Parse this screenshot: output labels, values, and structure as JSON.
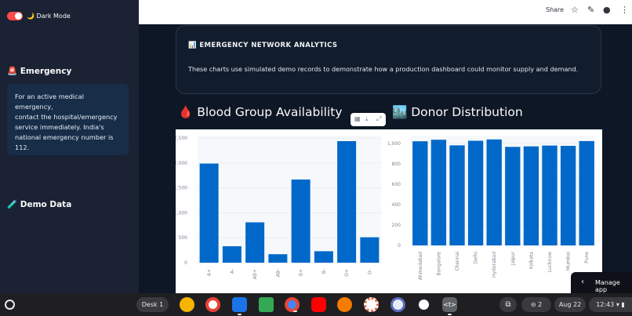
{
  "sidebar": {
    "toggle_label": "🌙 Dark Mode",
    "emergency_heading": "🚨 Emergency",
    "emergency_lines": [
      "For an active medical emergency,",
      "contact the hospital/emergency",
      "service immediately. India's",
      "national emergency number is",
      "112."
    ],
    "demo_heading": "🧪 Demo Data"
  },
  "topbar": {
    "share_label": "Share"
  },
  "card": {
    "title": "📊 EMERGENCY NETWORK ANALYTICS",
    "body": "These charts use simulated demo records to demonstrate how a production dashboard could monitor supply and demand."
  },
  "sections": {
    "blood_title": "🩸 Blood Group Availability",
    "donor_title": "🏙️ Donor Distribution"
  },
  "chart_data": [
    {
      "type": "bar",
      "categories": [
        "A+",
        "A-",
        "AB+",
        "AB-",
        "B+",
        "B-",
        "O+",
        "O-"
      ],
      "values": [
        1990,
        330,
        810,
        170,
        1670,
        230,
        2440,
        510
      ],
      "yticks": [
        "0",
        "500",
        "1,000",
        "1,500",
        "2,000",
        "2,500"
      ],
      "ylim": [
        0,
        2550
      ],
      "title": "",
      "color": "#0068c9"
    },
    {
      "type": "bar",
      "categories": [
        "Ahmedabad",
        "Bangalore",
        "Chennai",
        "Delhi",
        "Hyderabad",
        "Jaipur",
        "Kolkata",
        "Lucknow",
        "Mumbai",
        "Pune"
      ],
      "values": [
        1020,
        1035,
        980,
        1025,
        1038,
        965,
        970,
        978,
        975,
        1022
      ],
      "yticks": [
        "0",
        "200",
        "400",
        "600",
        "800",
        "1,000"
      ],
      "ylim": [
        0,
        1075
      ],
      "title": "",
      "color": "#0068c9"
    }
  ],
  "manage_app": {
    "label": "Manage app"
  },
  "taskbar": {
    "desk_label": "Desk 1",
    "notif_count": "2",
    "date": "Aug 22",
    "time": "12:43"
  }
}
